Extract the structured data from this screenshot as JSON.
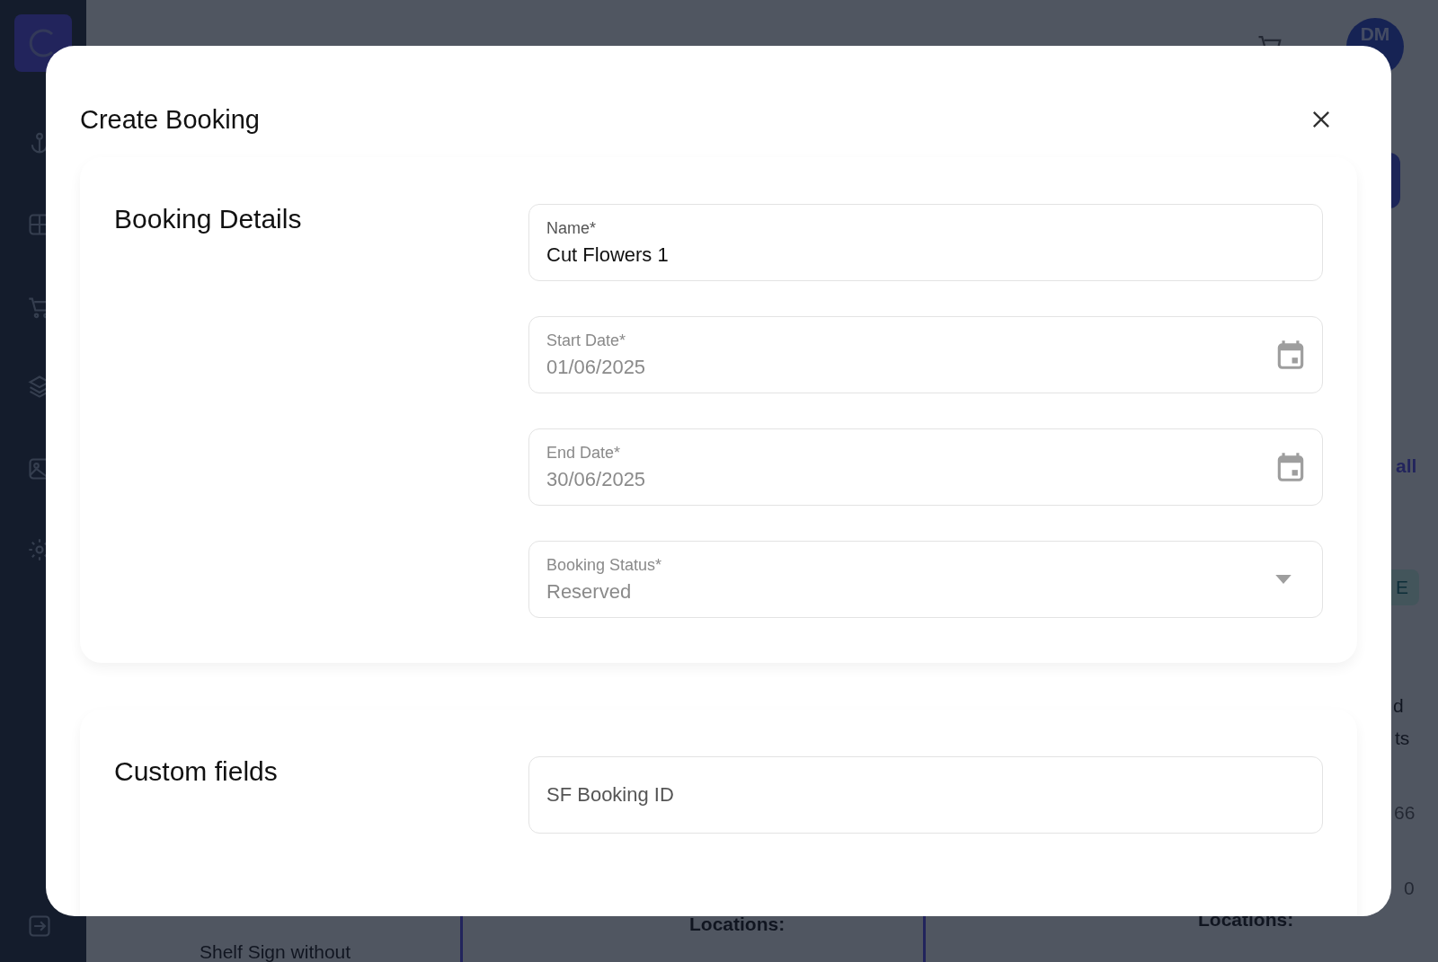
{
  "background": {
    "avatar_initials": "DM",
    "fragments": [
      {
        "kind": "link",
        "text": "all"
      },
      {
        "kind": "badge",
        "text": "E"
      },
      {
        "kind": "text",
        "text": "d"
      },
      {
        "kind": "text",
        "text": "ts"
      },
      {
        "kind": "number",
        "text": "66"
      },
      {
        "kind": "number",
        "text": "0"
      },
      {
        "kind": "label",
        "text": "Locations:"
      },
      {
        "kind": "label",
        "text": "Locations:"
      },
      {
        "kind": "text",
        "text": "Shelf Sign without"
      }
    ]
  },
  "modal": {
    "title": "Create Booking",
    "sections": [
      {
        "title": "Booking Details",
        "fields": [
          {
            "kind": "text",
            "label": "Name*",
            "value": "Cut Flowers 1",
            "disabled": false
          },
          {
            "kind": "date",
            "label": "Start Date*",
            "value": "01/06/2025",
            "disabled": true
          },
          {
            "kind": "date",
            "label": "End Date*",
            "value": "30/06/2025",
            "disabled": true
          },
          {
            "kind": "select",
            "label": "Booking Status*",
            "value": "Reserved",
            "disabled": true
          }
        ]
      },
      {
        "title": "Custom fields",
        "fields": [
          {
            "kind": "text",
            "placeholder": "SF Booking ID",
            "disabled": false
          }
        ]
      }
    ]
  }
}
